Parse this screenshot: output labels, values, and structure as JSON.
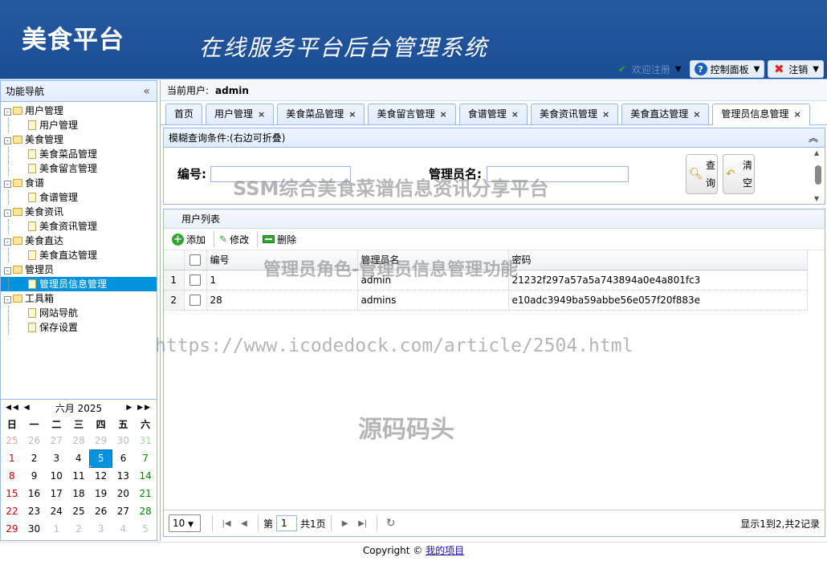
{
  "header": {
    "logo": "美食平台",
    "system_title": "在线服务平台后台管理系统"
  },
  "topbar": {
    "welcome": "欢迎注册",
    "control_panel": "控制面板",
    "logout": "注销"
  },
  "sidebar": {
    "title": "功能导航",
    "tree": [
      {
        "label": "用户管理",
        "children": [
          "用户管理"
        ]
      },
      {
        "label": "美食管理",
        "children": [
          "美食菜品管理",
          "美食留言管理"
        ]
      },
      {
        "label": "食谱",
        "children": [
          "食谱管理"
        ]
      },
      {
        "label": "美食资讯",
        "children": [
          "美食资讯管理"
        ]
      },
      {
        "label": "美食直达",
        "children": [
          "美食直达管理"
        ]
      },
      {
        "label": "管理员",
        "children": [
          "管理员信息管理"
        ]
      },
      {
        "label": "工具箱",
        "children": [
          "网站导航",
          "保存设置"
        ]
      }
    ],
    "selected": "管理员信息管理"
  },
  "calendar": {
    "month_label": "六月 2025",
    "weekdays": [
      "日",
      "一",
      "二",
      "三",
      "四",
      "五",
      "六"
    ],
    "weeks": [
      [
        25,
        26,
        27,
        28,
        29,
        30,
        31
      ],
      [
        1,
        2,
        3,
        4,
        5,
        6,
        7
      ],
      [
        8,
        9,
        10,
        11,
        12,
        13,
        14
      ],
      [
        15,
        16,
        17,
        18,
        19,
        20,
        21
      ],
      [
        22,
        23,
        24,
        25,
        26,
        27,
        28
      ],
      [
        29,
        30,
        1,
        2,
        3,
        4,
        5
      ]
    ],
    "today": 5
  },
  "main": {
    "current_user_label": "当前用户:",
    "current_user": "admin",
    "tabs": [
      "首页",
      "用户管理",
      "美食菜品管理",
      "美食留言管理",
      "食谱管理",
      "美食资讯管理",
      "美食直达管理",
      "管理员信息管理"
    ],
    "query": {
      "title": "模糊查询条件:(右边可折叠)",
      "field1_label": "编号:",
      "field2_label": "管理员名:",
      "btn_query": "查询",
      "btn_clear": "清空"
    },
    "grid": {
      "title": "用户列表",
      "toolbar": {
        "add": "添加",
        "edit": "修改",
        "delete": "删除"
      },
      "columns": [
        "编号",
        "管理员名",
        "密码"
      ],
      "rows": [
        {
          "rn": "1",
          "id": "1",
          "name": "admin",
          "pwd": "21232f297a57a5a743894a0e4a801fc3"
        },
        {
          "rn": "2",
          "id": "28",
          "name": "admins",
          "pwd": "e10adc3949ba59abbe56e057f20f883e"
        }
      ]
    },
    "pager": {
      "page_size": "10",
      "page_prefix": "第",
      "page": "1",
      "page_suffix": "共1页",
      "info": "显示1到2,共2记录"
    }
  },
  "footer": {
    "text": "Copyright ©",
    "link": "我的项目"
  },
  "watermarks": {
    "w1": "SSM综合美食菜谱信息资讯分享平台",
    "w2": "管理员角色-管理员信息管理功能",
    "w3": "https://www.icodedock.com/article/2504.html",
    "w4": "源码码头"
  }
}
